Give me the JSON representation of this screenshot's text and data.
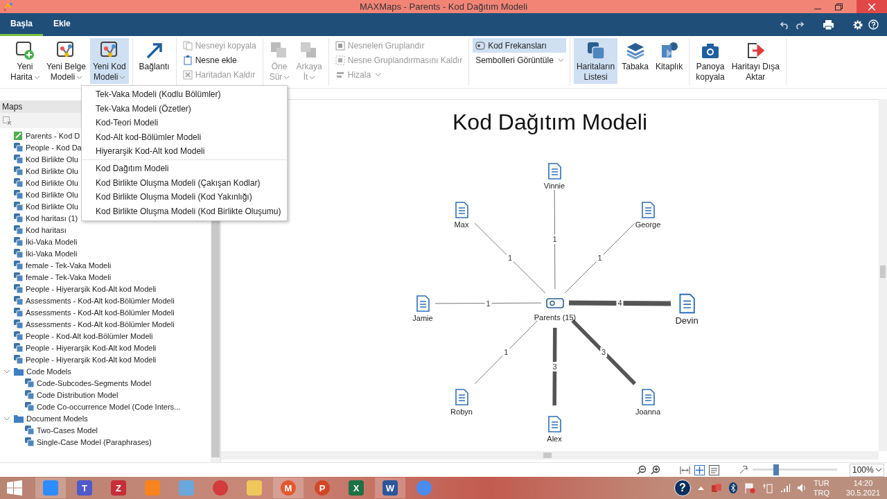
{
  "window": {
    "title": "MAXMaps - Parents - Kod Dağıtım Modeli"
  },
  "tabs": [
    {
      "label": "Başla",
      "selected": true
    },
    {
      "label": "Ekle",
      "selected": false
    }
  ],
  "ribbon": {
    "groups": [
      {
        "kind": "large",
        "buttons": [
          {
            "label": "Yeni\nHarita",
            "dropdown": true,
            "disabled": false,
            "selected": false
          },
          {
            "label": "Yeni Belge\nModeli",
            "dropdown": true,
            "disabled": false,
            "selected": false
          },
          {
            "label": "Yeni Kod\nModeli",
            "dropdown": true,
            "disabled": false,
            "selected": true
          }
        ]
      },
      {
        "kind": "large",
        "buttons": [
          {
            "label": "Bağlantı",
            "dropdown": false,
            "disabled": false,
            "selected": false
          }
        ]
      },
      {
        "kind": "small",
        "buttons": [
          {
            "label": "Nesneyi kopyala",
            "dropdown": false,
            "disabled": true,
            "selected": false
          },
          {
            "label": "Nesne ekle",
            "dropdown": false,
            "disabled": false,
            "selected": false
          },
          {
            "label": "Haritadan Kaldır",
            "dropdown": false,
            "disabled": true,
            "selected": false
          }
        ]
      },
      {
        "kind": "large",
        "buttons": [
          {
            "label": "Öne\nSür",
            "dropdown": true,
            "disabled": true,
            "selected": false
          },
          {
            "label": "Arkaya\nİt",
            "dropdown": true,
            "disabled": true,
            "selected": false
          }
        ]
      },
      {
        "kind": "small",
        "buttons": [
          {
            "label": "Nesneleri Gruplandır",
            "dropdown": false,
            "disabled": true,
            "selected": false
          },
          {
            "label": "Nesne Gruplandırmasını Kaldır",
            "dropdown": false,
            "disabled": true,
            "selected": false
          },
          {
            "label": "Hizala",
            "dropdown": true,
            "disabled": true,
            "selected": false
          }
        ]
      },
      {
        "kind": "small",
        "buttons": [
          {
            "label": "Kod Frekansları",
            "dropdown": false,
            "disabled": false,
            "selected": true
          },
          {
            "label": "Sembolleri Görüntüle",
            "dropdown": true,
            "disabled": false,
            "selected": false
          }
        ]
      },
      {
        "kind": "large",
        "buttons": [
          {
            "label": "Haritaların\nListesi",
            "dropdown": false,
            "disabled": false,
            "selected": true
          },
          {
            "label": "Tabaka",
            "dropdown": false,
            "disabled": false,
            "selected": false
          },
          {
            "label": "Kitaplık",
            "dropdown": false,
            "disabled": false,
            "selected": false
          }
        ]
      },
      {
        "kind": "large",
        "buttons": [
          {
            "label": "Panoya\nkopyala",
            "dropdown": false,
            "disabled": false,
            "selected": false
          },
          {
            "label": "Haritayı Dışa\nAktar",
            "dropdown": false,
            "disabled": false,
            "selected": false
          }
        ]
      }
    ]
  },
  "menu": {
    "sections": [
      [
        "Tek-Vaka Modeli (Kodlu Bölümler)",
        "Tek-Vaka Modeli (Özetler)",
        "Kod-Teori Modeli",
        "Kod-Alt kod-Bölümler Modeli",
        "Hiyerarşik Kod-Alt kod Modeli"
      ],
      [
        "Kod Dağıtım Modeli",
        "Kod Birlikte Oluşma Modeli (Çakışan Kodlar)",
        "Kod Birlikte Oluşma Modeli (Kod Yakınlığı)",
        "Kod Birlikte Oluşma Modeli (Kod Birlikte Oluşumu)"
      ]
    ]
  },
  "maps_panel": {
    "title": "Maps",
    "items": [
      {
        "kind": "current",
        "label": "Parents - Kod D"
      },
      {
        "kind": "map",
        "label": "People - Kod Da"
      },
      {
        "kind": "map",
        "label": "Kod Birlikte Olu"
      },
      {
        "kind": "map",
        "label": "Kod Birlikte Olu"
      },
      {
        "kind": "map",
        "label": "Kod Birlikte Olu"
      },
      {
        "kind": "map",
        "label": "Kod Birlikte Olu"
      },
      {
        "kind": "map",
        "label": "Kod Birlikte Olu"
      },
      {
        "kind": "map",
        "label": "Kod haritası (1)"
      },
      {
        "kind": "map",
        "label": "Kod haritası"
      },
      {
        "kind": "map",
        "label": "İki-Vaka Modeli"
      },
      {
        "kind": "map",
        "label": "İki-Vaka Modeli"
      },
      {
        "kind": "map",
        "label": "female - Tek-Vaka Modeli"
      },
      {
        "kind": "map",
        "label": "female - Tek-Vaka Modeli"
      },
      {
        "kind": "map",
        "label": "People - Hiyerarşik Kod-Alt kod Modeli"
      },
      {
        "kind": "map",
        "label": "Assessments - Kod-Alt kod-Bölümler Modeli"
      },
      {
        "kind": "map",
        "label": "Assessments - Kod-Alt kod-Bölümler Modeli"
      },
      {
        "kind": "map",
        "label": "Assessments - Kod-Alt kod-Bölümler Modeli"
      },
      {
        "kind": "map",
        "label": "People - Kod-Alt kod-Bölümler Modeli"
      },
      {
        "kind": "map",
        "label": "People - Hiyerarşik Kod-Alt kod Modeli"
      },
      {
        "kind": "map",
        "label": "People - Hiyerarşik Kod-Alt kod Modeli"
      },
      {
        "kind": "folder",
        "label": "Code Models",
        "expanded": true,
        "children": [
          {
            "kind": "map",
            "label": "Code-Subcodes-Segments Model"
          },
          {
            "kind": "map",
            "label": "Code Distribution Model"
          },
          {
            "kind": "map",
            "label": "Code Co-occurrence Model (Code Inters..."
          }
        ]
      },
      {
        "kind": "folder",
        "label": "Document Models",
        "expanded": true,
        "children": [
          {
            "kind": "map",
            "label": "Two-Cases Model"
          },
          {
            "kind": "map",
            "label": "Single-Case Model (Paraphrases)"
          }
        ]
      }
    ]
  },
  "map": {
    "title": "Kod Dağıtım Modeli",
    "center": {
      "label": "Parents (15)"
    },
    "nodes": [
      {
        "label": "Vinnie",
        "edge": "1",
        "selected": false
      },
      {
        "label": "Max",
        "edge": "1",
        "selected": false
      },
      {
        "label": "George",
        "edge": "1",
        "selected": false
      },
      {
        "label": "Jamie",
        "edge": "1",
        "selected": false
      },
      {
        "label": "Devin",
        "edge": "4",
        "selected": true
      },
      {
        "label": "Robyn",
        "edge": "1",
        "selected": false
      },
      {
        "label": "Joanna",
        "edge": "3",
        "selected": false
      },
      {
        "label": "Alex",
        "edge": "3",
        "selected": false
      }
    ]
  },
  "status_bar": {
    "zoom": {
      "level": 0.28
    },
    "zoom_select": "100%"
  },
  "taskbar": {
    "apps": [
      {
        "kind": "square",
        "color": "#2d8cff",
        "selected": true
      },
      {
        "kind": "square",
        "color": "#5059c9",
        "glyph": "T",
        "selected": false
      },
      {
        "kind": "square",
        "color": "#c62e3a",
        "glyph": "Z",
        "selected": false
      },
      {
        "kind": "square",
        "color": "#f7841e",
        "selected": false
      },
      {
        "kind": "square",
        "color": "#6aa7da",
        "selected": false
      },
      {
        "kind": "circle",
        "color": "#d23c3c",
        "selected": false
      },
      {
        "kind": "square",
        "color": "#f0c75a",
        "selected": false
      },
      {
        "kind": "circle",
        "color": "#e4572e",
        "glyph": "M",
        "selected": true
      },
      {
        "kind": "circle",
        "color": "#d24726",
        "glyph": "P",
        "selected": false
      },
      {
        "kind": "square",
        "color": "#1e7145",
        "glyph": "X",
        "selected": false
      },
      {
        "kind": "square",
        "color": "#2b579a",
        "glyph": "W",
        "selected": true
      },
      {
        "kind": "circle",
        "color": "#4a8af4",
        "selected": false
      }
    ],
    "tray": {
      "help": "?",
      "lang": "TUR",
      "layout": "TRQ",
      "time": "14:20",
      "date": "30.5.2021"
    }
  }
}
